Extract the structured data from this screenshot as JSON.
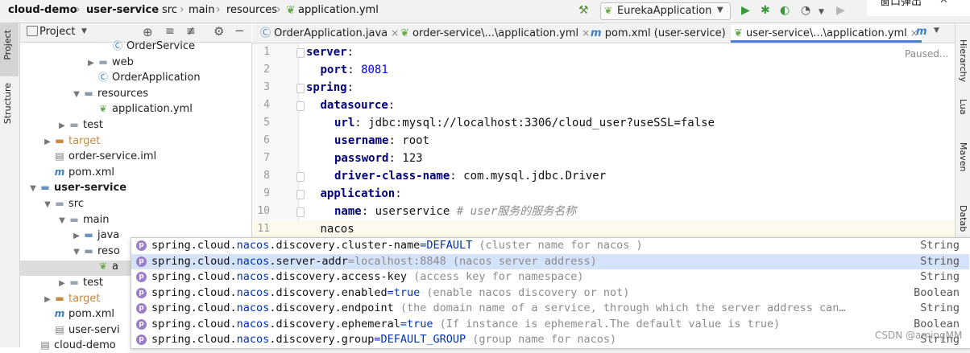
{
  "breadcrumbs": [
    "cloud-demo",
    "user-service",
    "src",
    "main",
    "resources",
    "application.yml"
  ],
  "run_config": "EurekaApplication",
  "toolbar_overflow_text": "窗口弹出",
  "project_panel": {
    "title": "Project",
    "tree": [
      {
        "label": "OrderService",
        "icon": "class-icon",
        "level": 6
      },
      {
        "label": "web",
        "icon": "folder-icon",
        "level": 5,
        "arrow": "collapsed"
      },
      {
        "label": "OrderApplication",
        "icon": "spring-class-icon",
        "level": 5
      },
      {
        "label": "resources",
        "icon": "resources-folder-icon",
        "level": 4,
        "arrow": "expanded"
      },
      {
        "label": "application.yml",
        "icon": "yaml-icon",
        "level": 5
      },
      {
        "label": "test",
        "icon": "folder-icon",
        "level": 3,
        "arrow": "collapsed"
      },
      {
        "label": "target",
        "icon": "folder-orange-icon",
        "level": 2,
        "arrow": "collapsed"
      },
      {
        "label": "order-service.iml",
        "icon": "iml-icon",
        "level": 2
      },
      {
        "label": "pom.xml",
        "icon": "maven-icon",
        "level": 2
      },
      {
        "label": "user-service",
        "icon": "module-icon",
        "level": 1,
        "arrow": "expanded",
        "bold": true
      },
      {
        "label": "src",
        "icon": "folder-icon",
        "level": 2,
        "arrow": "expanded"
      },
      {
        "label": "main",
        "icon": "folder-icon",
        "level": 3,
        "arrow": "expanded"
      },
      {
        "label": "java",
        "icon": "source-folder-icon",
        "level": 4,
        "arrow": "collapsed"
      },
      {
        "label": "reso",
        "icon": "resources-folder-icon",
        "level": 4,
        "arrow": "expanded"
      },
      {
        "label": "a",
        "icon": "yaml-icon",
        "level": 5,
        "selected": true
      },
      {
        "label": "test",
        "icon": "folder-icon",
        "level": 3,
        "arrow": "collapsed"
      },
      {
        "label": "target",
        "icon": "folder-orange-icon",
        "level": 2,
        "arrow": "collapsed"
      },
      {
        "label": "pom.xml",
        "icon": "maven-icon",
        "level": 2
      },
      {
        "label": "user-servi",
        "icon": "iml-icon",
        "level": 2
      },
      {
        "label": "cloud-demo",
        "icon": "iml-icon",
        "level": 1
      }
    ]
  },
  "tabs": [
    {
      "label": "OrderApplication.java",
      "icon": "class-icon"
    },
    {
      "label": "order-service\\...\\application.yml",
      "icon": "yaml-icon"
    },
    {
      "label": "pom.xml (user-service)",
      "icon": "maven-icon"
    },
    {
      "label": "user-service\\...\\application.yml",
      "icon": "yaml-icon",
      "active": true
    }
  ],
  "editor": {
    "status": "Paused...",
    "lines": [
      {
        "n": "1",
        "key": "server",
        "sep": ":",
        "val": "",
        "comment": "",
        "indent": 0
      },
      {
        "n": "2",
        "key": "port",
        "sep": ": ",
        "val": "8081",
        "comment": "",
        "indent": 1,
        "numeric": true
      },
      {
        "n": "3",
        "key": "spring",
        "sep": ":",
        "val": "",
        "comment": "",
        "indent": 0
      },
      {
        "n": "4",
        "key": "datasource",
        "sep": ":",
        "val": "",
        "comment": "",
        "indent": 1
      },
      {
        "n": "5",
        "key": "url",
        "sep": ": ",
        "val": "jdbc:mysql://localhost:3306/cloud_user?useSSL=false",
        "comment": "",
        "indent": 2
      },
      {
        "n": "6",
        "key": "username",
        "sep": ": ",
        "val": "root",
        "comment": "",
        "indent": 2
      },
      {
        "n": "7",
        "key": "password",
        "sep": ": ",
        "val": "123",
        "comment": "",
        "indent": 2
      },
      {
        "n": "8",
        "key": "driver-class-name",
        "sep": ": ",
        "val": "com.mysql.jdbc.Driver",
        "comment": "",
        "indent": 2
      },
      {
        "n": "9",
        "key": "application",
        "sep": ":",
        "val": "",
        "comment": "",
        "indent": 1
      },
      {
        "n": "10",
        "key": "name",
        "sep": ": ",
        "val": "userservice ",
        "comment": "# user服务的服务名称",
        "indent": 2
      },
      {
        "n": "11",
        "key": "",
        "sep": "",
        "val": "nacos",
        "comment": "",
        "indent": 1
      }
    ]
  },
  "completion": [
    {
      "prefix": "spring.cloud.",
      "match": "nacos",
      "rest": ".discovery.cluster-name",
      "value": "=DEFAULT",
      "desc": " (cluster name for nacos )",
      "type": "String"
    },
    {
      "prefix": "spring.cloud.",
      "match": "nacos",
      "rest": ".server-addr",
      "value": "=localhost:8848",
      "desc": " (nacos server address)",
      "type": "String",
      "selected": true
    },
    {
      "prefix": "spring.cloud.",
      "match": "nacos",
      "rest": ".discovery.access-key",
      "value": "",
      "desc": " (access key for namespace)",
      "type": "String"
    },
    {
      "prefix": "spring.cloud.",
      "match": "nacos",
      "rest": ".discovery.enabled",
      "value": "=true",
      "desc": " (enable nacos discovery or not)",
      "type": "Boolean"
    },
    {
      "prefix": "spring.cloud.",
      "match": "nacos",
      "rest": ".discovery.endpoint",
      "value": "",
      "desc": " (the domain name of a service, through which the server address can…",
      "type": "String"
    },
    {
      "prefix": "spring.cloud.",
      "match": "nacos",
      "rest": ".discovery.ephemeral",
      "value": "=true",
      "desc": " (If instance is ephemeral.The default value is true)",
      "type": "Boolean"
    },
    {
      "prefix": "spring.cloud.",
      "match": "nacos",
      "rest": ".discovery.group",
      "value": "=DEFAULT_GROUP",
      "desc": " (group name for nacos)",
      "type": "String"
    }
  ],
  "left_tools": [
    "Project",
    "Structure"
  ],
  "right_tools": [
    "Hierarchy",
    "Lua",
    "Maven",
    "Datab"
  ],
  "watermark": "CSDN @amingMM"
}
